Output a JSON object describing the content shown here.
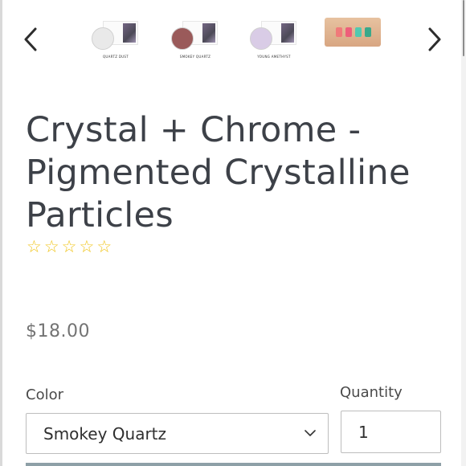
{
  "gallery": {
    "prev_label": "previous",
    "next_label": "next",
    "thumbnails": [
      {
        "caption": "QUARTZ DUST",
        "pot_color": "#e9e9e9"
      },
      {
        "caption": "SMOKEY QUARTZ",
        "pot_color": "#9a5a5a"
      },
      {
        "caption": "YOUNG AMETHYST",
        "pot_color": "#d9cce6"
      },
      {
        "caption": "",
        "swatches": [
          "#f07a7a",
          "#ee5e7a",
          "#51c9b0",
          "#3aa88a"
        ]
      }
    ]
  },
  "product": {
    "title": "Crystal + Chrome - Pigmented Crystalline Particles",
    "rating": {
      "filled": 0,
      "out_of": 5
    },
    "price": "$18.00"
  },
  "options": {
    "color_label": "Color",
    "color_value": "Smokey Quartz",
    "quantity_label": "Quantity",
    "quantity_value": "1"
  },
  "colors": {
    "star": "#f0c419",
    "accent_bar": "#8ea0a7"
  }
}
